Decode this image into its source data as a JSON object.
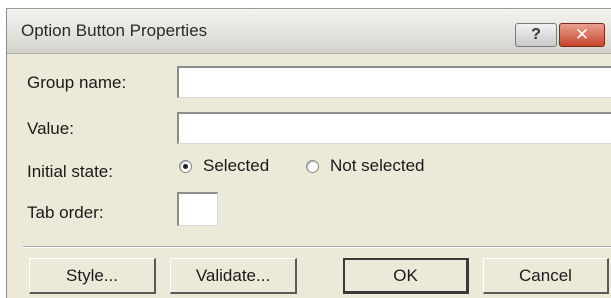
{
  "dialog": {
    "title": "Option Button Properties",
    "help_label": "?",
    "close_label": "✕"
  },
  "form": {
    "group_name_label": "Group name:",
    "group_name_value": "",
    "value_label": "Value:",
    "value_value": "",
    "initial_state_label": "Initial state:",
    "initial_state_options": [
      {
        "label": "Selected",
        "checked": true
      },
      {
        "label": "Not selected",
        "checked": false
      }
    ],
    "tab_order_label": "Tab order:",
    "tab_order_value": ""
  },
  "buttons": {
    "style_label": "Style...",
    "validate_label": "Validate...",
    "ok_label": "OK",
    "cancel_label": "Cancel"
  },
  "colors": {
    "dialog_background": "#ece9d8",
    "close_button": "#c7452c"
  }
}
